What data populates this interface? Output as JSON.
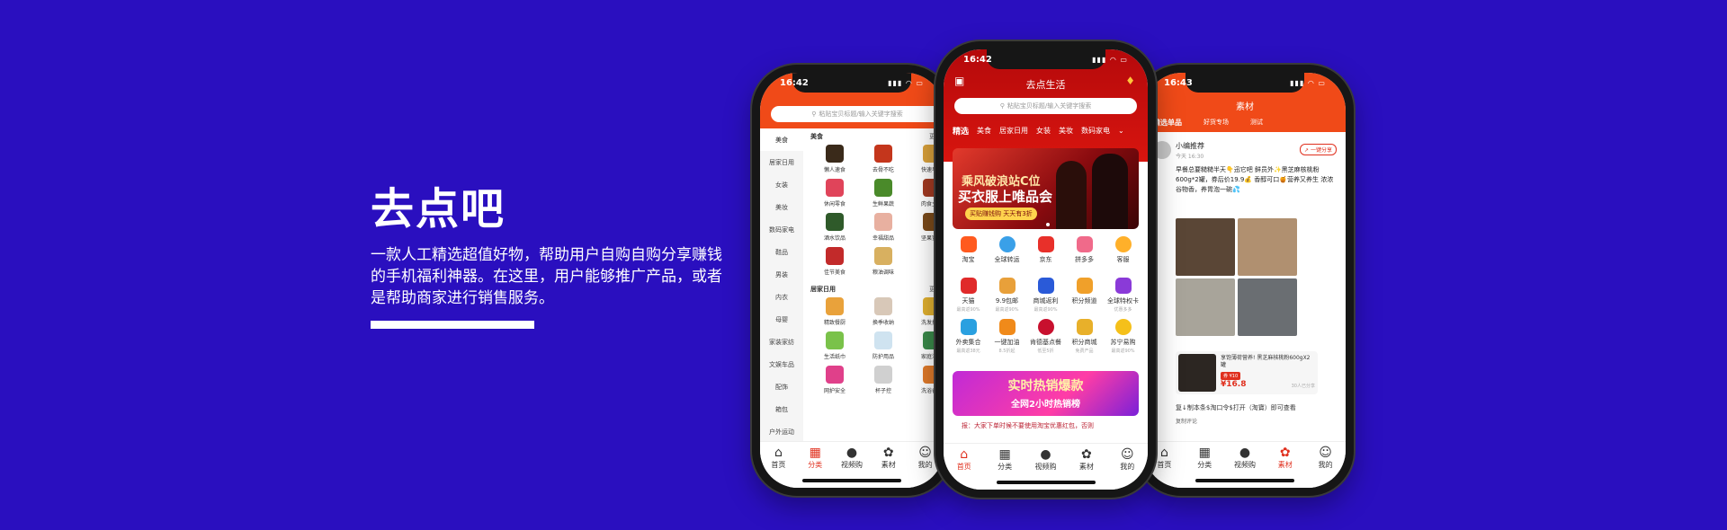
{
  "hero": {
    "title": "去点吧",
    "description": "一款人工精选超值好物，帮助用户自购自购分享赚钱的手机福利神器。在这里，用户能够推广产品，或者是帮助商家进行销售服务。"
  },
  "colors": {
    "background": "#2a0fbf",
    "accent_orange": "#f04a18",
    "accent_red": "#c00d0d"
  },
  "phone_left": {
    "time": "16:42",
    "search_placeholder": "粘贴宝贝标题/输入关键字搜索",
    "sidebar": [
      "美食",
      "居家日用",
      "女装",
      "美妆",
      "数码家电",
      "鞋品",
      "男装",
      "内衣",
      "母婴",
      "家装家纺",
      "文娱车品",
      "配饰",
      "箱包",
      "户外运动"
    ],
    "sections": [
      {
        "title": "美食",
        "more": "更多",
        "items": [
          "懒人速食",
          "去骨不吃",
          "快速早餐",
          "休闲零食",
          "生鲜果蔬",
          "肉食主义",
          "酒水饮品",
          "幸福甜品",
          "坚果蜜饯",
          "佳节美食",
          "粮油调味"
        ]
      },
      {
        "title": "居家日用",
        "more": "更多",
        "items": [
          "精致餐厨",
          "换季收纳",
          "洗发护发",
          "生活纸巾",
          "防护用品",
          "家庭清洁",
          "网护安全",
          "杯子控",
          "洗浴香体"
        ]
      }
    ],
    "tabbar": [
      "首页",
      "分类",
      "视频购",
      "素材",
      "我的"
    ]
  },
  "phone_mid": {
    "time": "16:42",
    "title": "去点生活",
    "search_placeholder": "粘贴宝贝标题/输入关键字搜索",
    "categories": [
      "精选",
      "美食",
      "居家日用",
      "女装",
      "美妆",
      "数码家电"
    ],
    "banner": {
      "line1": "乘风破浪站C位",
      "line2": "买衣服上唯品会",
      "badge": "买贴赚钱购 天天有3折"
    },
    "icons": [
      {
        "label": "淘宝",
        "sub": ""
      },
      {
        "label": "全球转运",
        "sub": ""
      },
      {
        "label": "京东",
        "sub": ""
      },
      {
        "label": "拼多多",
        "sub": ""
      },
      {
        "label": "客服",
        "sub": ""
      },
      {
        "label": "天猫",
        "sub": "最高返90%"
      },
      {
        "label": "9.9包邮",
        "sub": "最高返90%"
      },
      {
        "label": "商城返利",
        "sub": "最高返90%"
      },
      {
        "label": "积分频道",
        "sub": ""
      },
      {
        "label": "全球特权卡",
        "sub": "优惠多多"
      },
      {
        "label": "外卖集合",
        "sub": "最高返38元"
      },
      {
        "label": "一键加油",
        "sub": "8.5折起"
      },
      {
        "label": "肯德基点餐",
        "sub": "低至5折"
      },
      {
        "label": "积分商城",
        "sub": "免费产品"
      },
      {
        "label": "苏宁易购",
        "sub": "最高返90%"
      }
    ],
    "promo": {
      "line1": "实时热销爆款",
      "line2": "全网2小时热销榜"
    },
    "ticker": "报：大家下单时候不要使用淘宝优惠红包，否则",
    "tabbar": [
      "首页",
      "分类",
      "视频购",
      "素材",
      "我的"
    ]
  },
  "phone_right": {
    "time": "16:43",
    "title": "素材",
    "tabs": [
      "精选单品",
      "好货专场",
      "测试"
    ],
    "post": {
      "author": "小编推荐",
      "date": "今天 16:30",
      "share": "一键分享",
      "text": "早餐总要糙糙半天👇迅它吧 鲜员外✨黑芝麻核桃粉 600g*2罐，券后价19.9💰 香醇可口🍯营养又养生 浓浓谷物香，养胃泡一碗💦",
      "goods_title": "享饱薄荷营养! 黑芝麻核桃粉600gX2罐",
      "coupon": "券 ¥10",
      "price": "¥16.8",
      "sold": "30人已分享",
      "copy_text": "复↓制本条$淘口令$打开（淘寶）即可查看",
      "comment": "复制评论"
    },
    "tabbar": [
      "首页",
      "分类",
      "视频购",
      "素材",
      "我的"
    ]
  }
}
